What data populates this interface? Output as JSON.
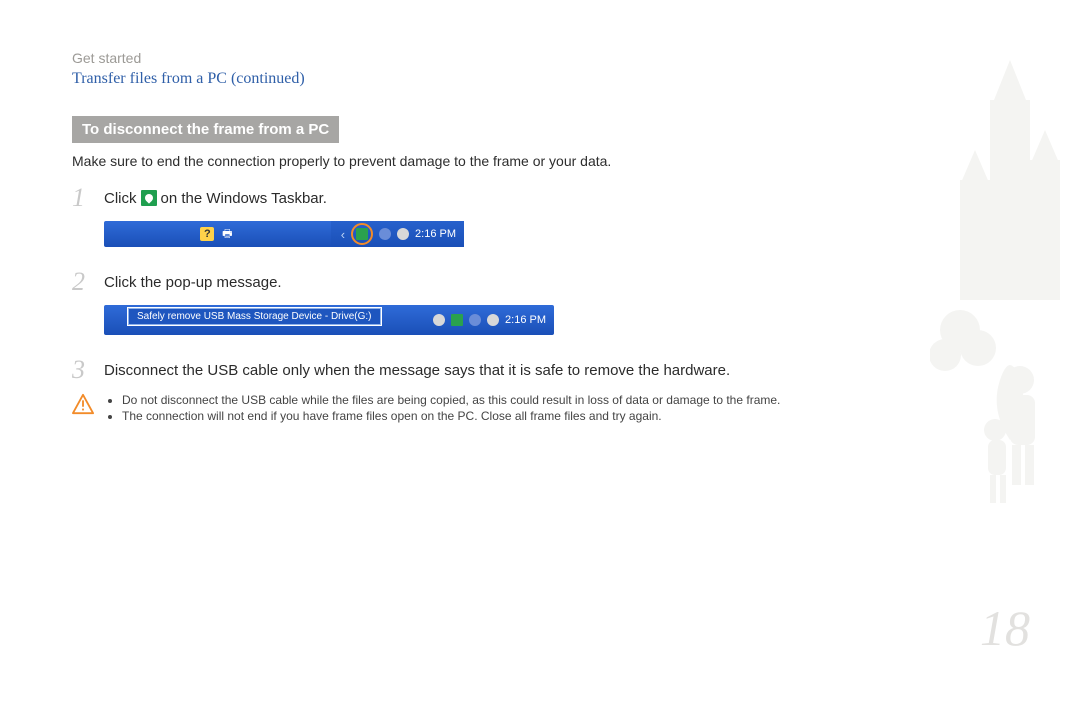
{
  "chapter": "Get started",
  "section_title": "Transfer files from a PC  (continued)",
  "subheading": "To disconnect the frame from a PC",
  "intro": "Make sure to end the connection properly to prevent damage to the frame or your data.",
  "steps": {
    "s1": {
      "num": "1",
      "pre": "Click",
      "post": "on the Windows Taskbar."
    },
    "s2": {
      "num": "2",
      "text": "Click the pop-up message."
    },
    "s3": {
      "num": "3",
      "text": "Disconnect the USB cable only when the message says that it is safe to remove the hardware."
    }
  },
  "taskbar": {
    "time": "2:16 PM",
    "popup_message": "Safely remove USB Mass Storage Device - Drive(G:)"
  },
  "warnings": {
    "w1": "Do not disconnect the USB cable while the files are being copied, as this could result in loss of data or damage to the frame.",
    "w2": "The connection will not end if you have frame files open on the PC. Close all frame files and try again."
  },
  "page_number": "18"
}
